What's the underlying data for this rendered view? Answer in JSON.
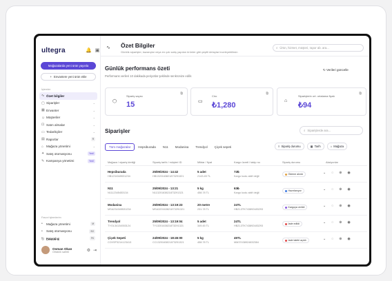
{
  "sidebar": {
    "logo_main": "ultegra",
    "primary_button": "Mağazalarda yeni ürün yayınla",
    "secondary_button": "Envantere yeni ürün ekle",
    "section_menu": "İşlemler",
    "items": [
      {
        "label": "Özet bilgiler",
        "icon": "pulse-icon",
        "active": true
      },
      {
        "label": "Siparişler",
        "icon": "box-icon",
        "suffix": "chevron"
      },
      {
        "label": "Envanter",
        "icon": "grid-icon",
        "suffix": "chevron"
      },
      {
        "label": "Müşteriler",
        "icon": "users-icon",
        "suffix": "chevron"
      },
      {
        "label": "Satın almalar",
        "icon": "cart-icon",
        "suffix": "chevron"
      },
      {
        "label": "Tedarikçiler",
        "icon": "truck-icon",
        "suffix": "chevron"
      },
      {
        "label": "Raporlar",
        "icon": "report-icon",
        "suffix": "count",
        "count": "R"
      },
      {
        "label": "Mağaza yönetimi",
        "icon": "store-icon",
        "suffix": "chevron"
      },
      {
        "label": "Satış otomasyonu",
        "icon": "automation-icon",
        "suffix": "new",
        "badge": "Yeni!"
      },
      {
        "label": "Kampanya yönetimi",
        "icon": "campaign-icon",
        "suffix": "new",
        "badge": "Yeni!"
      }
    ],
    "section_fav": "Favori işlemlerim",
    "fav_items": [
      {
        "label": "Mağaza yönetimi",
        "key": "M"
      },
      {
        "label": "Satış otomasyonu",
        "key": "SO"
      },
      {
        "label": "Faturalar",
        "key": "FK"
      }
    ],
    "support": "Destek al",
    "user": {
      "name": "Osman Okan",
      "role": "Ortaklık sahibi"
    }
  },
  "header": {
    "title": "Özet Bilgiler",
    "subtitle": "Günlük siparişler, kazançlar veya en çok satış yapılan ürünler gibi çeşitli detaylar inceleyebilirsin",
    "search_placeholder": "Ürün, hizmet, müşteri, rapor ab. ara..."
  },
  "performance": {
    "title": "Günlük performans özeti",
    "subtitle": "Performans verileri 10 dakikada periyotlar şeklinde senkronize edilir.",
    "refresh": "Verileri güncelle",
    "cards": [
      {
        "label": "Sipariş sayısı",
        "value": "15",
        "icon": "cube-icon"
      },
      {
        "label": "Ciro",
        "value": "₺1,280",
        "icon": "cash-icon"
      },
      {
        "label": "Siparişlerin ort. ortalama fiyatı",
        "value": "₺94",
        "icon": "tag-icon"
      }
    ]
  },
  "orders": {
    "title": "Siparişler",
    "search_placeholder": "Siparişlerde ara...",
    "tabs": [
      "Tüm mağazalar",
      "Hepsiburada",
      "N11",
      "Modanisa",
      "Trendyol",
      "Çiçek sepeti"
    ],
    "active_tab": 0,
    "filters": [
      "Sipariş durumu",
      "Tarih",
      "Mağaza"
    ],
    "columns": [
      "Mağaza / sipariş kimliği",
      "Sipariş tarihi / müşteri ID",
      "Miktar / fiyat",
      "Kargo ücreti / takip no",
      "Sipariş durumu",
      "Aksiyonlar"
    ],
    "rows": [
      {
        "store": "Hepsiburada",
        "id": "HB1234345531234",
        "date": "25/09/2024 - 14:42",
        "cust": "HB1320163821873291321",
        "qty": "5 adet",
        "price": "2143.45 TL",
        "ship": "72₺",
        "track": "Kargo kodu aktif değil",
        "status": "Ödeme alındı",
        "color": "#e2a03f"
      },
      {
        "store": "N11",
        "id": "N1112345453134",
        "date": "25/09/2024 - 13:21",
        "cust": "N11320163821873291321",
        "qty": "5 kg",
        "price": "458.78 TL",
        "ship": "63₺",
        "track": "Kargo kodu aktif değil",
        "status": "Hazırlanıyor",
        "color": "#3f7be2"
      },
      {
        "store": "Modanisa",
        "id": "MSA234345531234",
        "date": "25/09/2024 - 13:19:23",
        "cust": "MSA320163821873291321",
        "qty": "20 metre",
        "price": "231.78 TL",
        "ship": "24TL",
        "track": "HBZL3TK743892483293",
        "status": "Kargoya verildi",
        "color": "#8a5be2"
      },
      {
        "store": "Trendyol",
        "id": "TYOL34134553124",
        "date": "25/09/2024 - 13:19:04",
        "cust": "TY1320163821873291321",
        "qty": "5 adet",
        "price": "349.45 TL",
        "ship": "24TL",
        "track": "HBZL3TK743892483293",
        "status": "İade edildi",
        "color": "#e24848"
      },
      {
        "store": "Çiçek Sepeti",
        "id": "CCKSP3214123413",
        "date": "24/09/2024 - 18:45:00",
        "cust": "CC1320163821873291321",
        "qty": "5 kg",
        "price": "458.78 TL",
        "ship": "45TL",
        "track": "MM37438924832384",
        "status": "İade talebi açıldı",
        "color": "#e24848"
      }
    ]
  }
}
